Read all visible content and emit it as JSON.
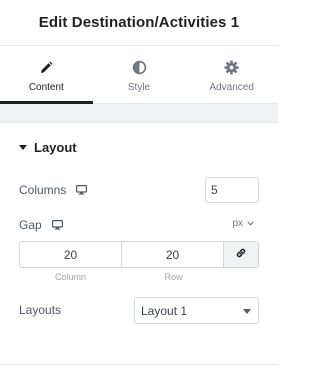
{
  "header": {
    "title": "Edit Destination/Activities 1"
  },
  "tabs": [
    {
      "label": "Content",
      "icon": "pencil-icon",
      "active": true
    },
    {
      "label": "Style",
      "icon": "half-circle-icon",
      "active": false
    },
    {
      "label": "Advanced",
      "icon": "gear-icon",
      "active": false
    }
  ],
  "section": {
    "title": "Layout"
  },
  "controls": {
    "columns": {
      "label": "Columns",
      "value": "5"
    },
    "gap": {
      "label": "Gap",
      "unit": "px",
      "column_value": "20",
      "row_value": "20",
      "column_label": "Column",
      "row_label": "Row"
    },
    "layouts": {
      "label": "Layouts",
      "selected": "Layout 1"
    }
  },
  "colors": {
    "text": "#3f444b",
    "heading": "#1f2124",
    "border": "#d5d8dc",
    "muted": "#9da5ae"
  }
}
